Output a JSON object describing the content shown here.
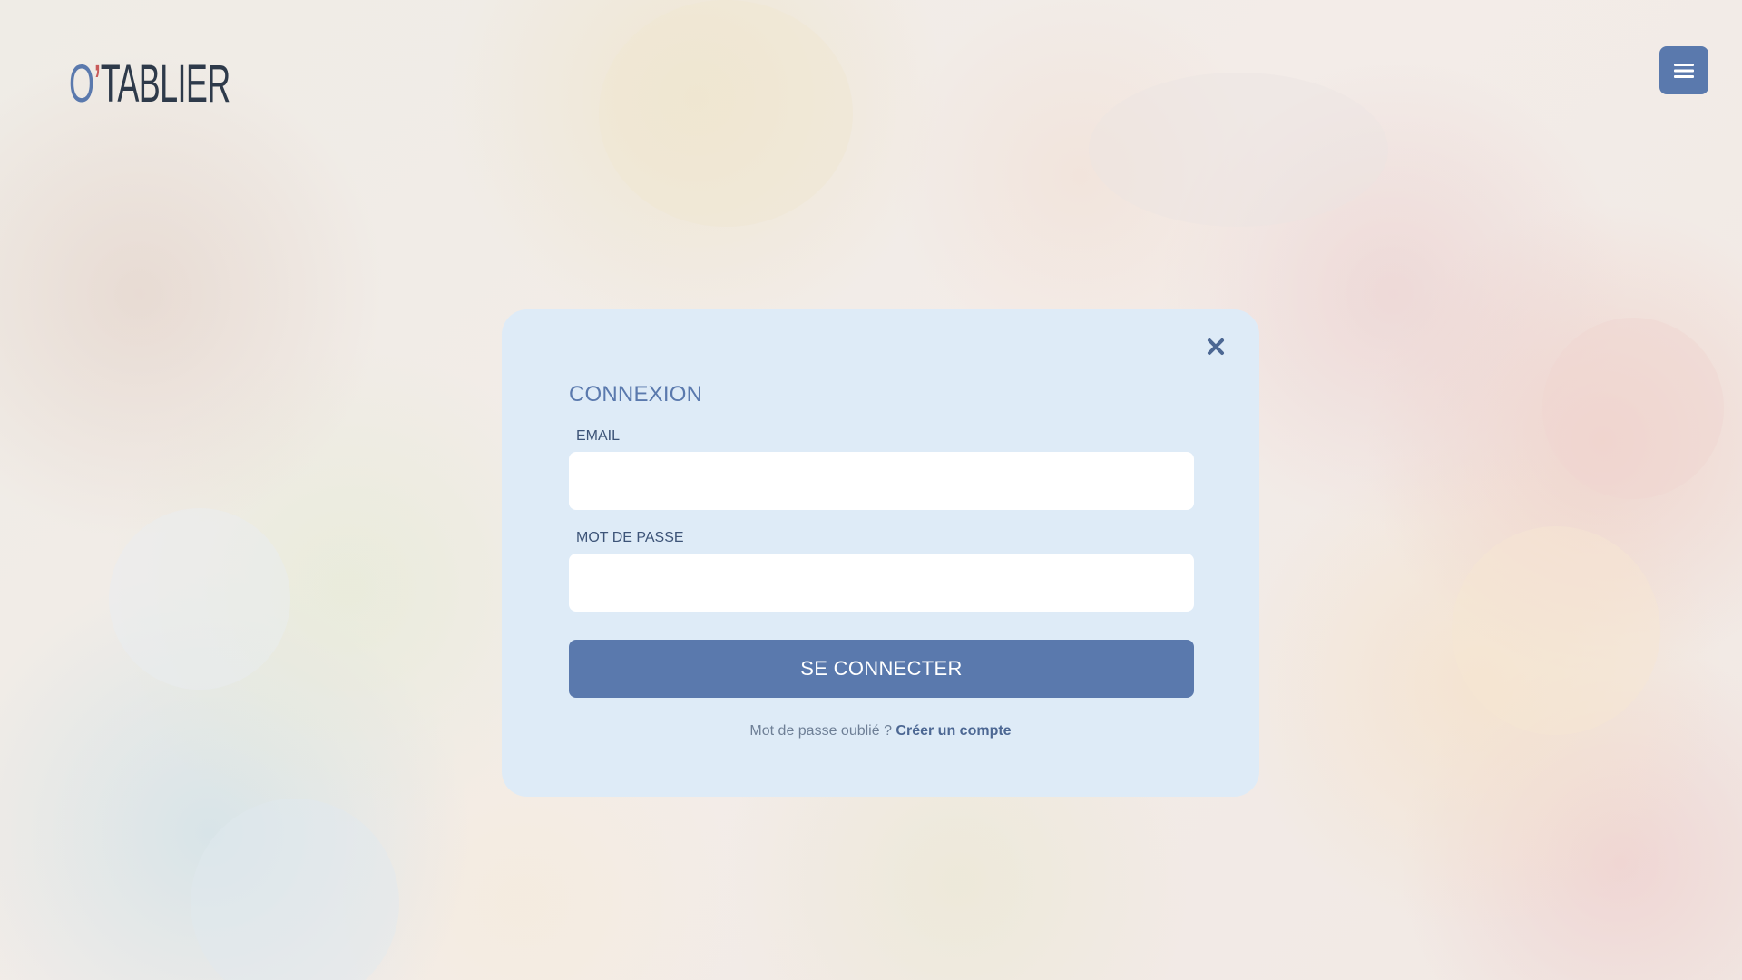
{
  "header": {
    "logo": {
      "prefix": "O",
      "apostrophe": "’",
      "name": "TABLIER",
      "icon": "clock-icon"
    },
    "menu_button": {
      "icon": "hamburger-menu-icon"
    }
  },
  "login_modal": {
    "title": "CONNEXION",
    "close_icon": "close-icon",
    "email": {
      "label": "EMAIL",
      "value": "",
      "placeholder": ""
    },
    "password": {
      "label": "MOT DE PASSE",
      "value": "",
      "placeholder": ""
    },
    "submit_label": "SE CONNECTER",
    "forgot_password_link": "Mot de passe oublié ?",
    "create_account_link": "Créer un compte"
  },
  "colors": {
    "primary": "#5a79ad",
    "modal_background": "#deebf7",
    "logo_accent": "#c85a5a",
    "logo_text": "#2e3a4a"
  }
}
